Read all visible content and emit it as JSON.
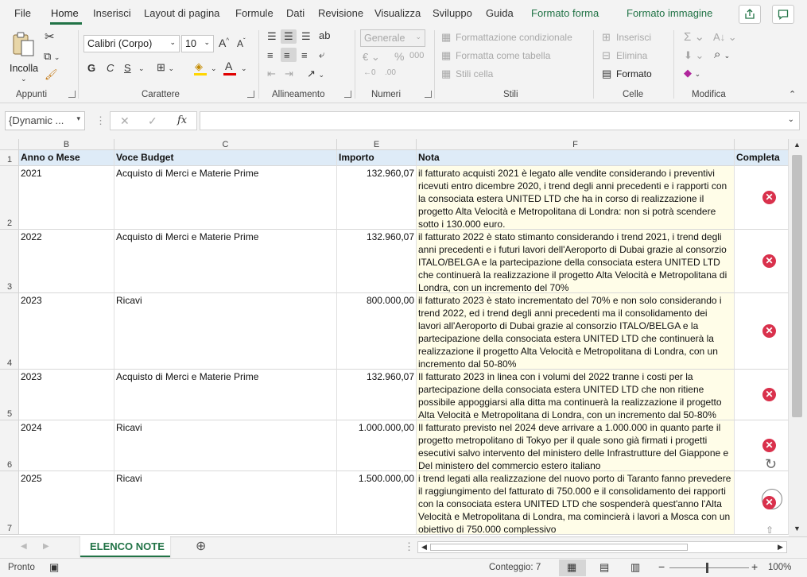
{
  "menu": {
    "items": [
      "File",
      "Home",
      "Inserisci",
      "Layout di pagina",
      "Formule",
      "Dati",
      "Revisione",
      "Visualizza",
      "Sviluppo",
      "Guida",
      "Formato forma",
      "Formato immagine"
    ]
  },
  "ribbon": {
    "clipboard": {
      "paste_label": "Incolla",
      "group_label": "Appunti"
    },
    "font": {
      "font_name": "Calibri (Corpo)",
      "font_size": "10",
      "bold": "G",
      "italic": "C",
      "underline": "S",
      "group_label": "Carattere"
    },
    "alignment": {
      "group_label": "Allineamento"
    },
    "number": {
      "format": "Generale",
      "group_label": "Numeri"
    },
    "styles": {
      "conditional": "Formattazione condizionale",
      "as_table": "Formatta come tabella",
      "cell_styles": "Stili cella",
      "group_label": "Stili"
    },
    "cells": {
      "insert": "Inserisci",
      "delete": "Elimina",
      "format": "Formato",
      "group_label": "Celle"
    },
    "editing": {
      "group_label": "Modifica"
    }
  },
  "formula_bar": {
    "name_box": "{Dynamic ...",
    "fx": "fx",
    "content": ""
  },
  "columns": [
    "B",
    "C",
    "E",
    "F"
  ],
  "headers": {
    "b": "Anno o Mese",
    "c": "Voce Budget",
    "e": "Importo",
    "f": "Nota",
    "g": "Completa"
  },
  "rows": [
    {
      "num": "2",
      "year": "2021",
      "item": "Acquisto di Merci e Materie Prime",
      "amount": "132.960,07",
      "note": "il fatturato acquisti 2021 è legato alle vendite considerando i preventivi ricevuti entro dicembre 2020, i trend degli anni precedenti e i rapporti con la consociata estera UNITED LTD che ha in corso di realizzazione il progetto Alta Velocità e Metropolitana di Londra: non si potrà scendere sotto i 130.000 euro."
    },
    {
      "num": "3",
      "year": "2022",
      "item": "Acquisto di Merci e Materie Prime",
      "amount": "132.960,07",
      "note": "il fatturato 2022 è stato stimanto considerando i trend 2021, i trend degli anni precedenti e i futuri lavori dell'Aeroporto di Dubai grazie al consorzio ITALO/BELGA e la partecipazione della consociata estera UNITED LTD che continuerà la realizzazione il progetto Alta Velocità e Metropolitana di Londra, con un incremento del 70%"
    },
    {
      "num": "4",
      "year": "2023",
      "item": "Ricavi",
      "amount": "800.000,00",
      "note": "il fatturato 2023 è stato incrementato del 70% e non solo considerando i trend 2022, ed  i trend degli anni precedenti ma il consolidamento dei lavori all'Aeroporto di Dubai grazie al consorzio ITALO/BELGA e la partecipazione della consociata estera UNITED LTD che continuerà la realizzazione il progetto Alta Velocità e Metropolitana di Londra, con un incremento dal 50-80%"
    },
    {
      "num": "5",
      "year": "2023",
      "item": "Acquisto di Merci e Materie Prime",
      "amount": "132.960,07",
      "note": "Il fatturato 2023 in linea con i volumi del 2022 tranne i costi per la partecipazione della consociata estera UNITED LTD che non ritiene possibile appoggiarsi alla ditta ma continuerà la realizzazione il progetto Alta Velocità e Metropolitana di Londra, con un incremento dal 50-80%"
    },
    {
      "num": "6",
      "year": "2024",
      "item": "Ricavi",
      "amount": "1.000.000,00",
      "note": "Il fatturato previsto nel 2024 deve arrivare a 1.000.000 in quanto parte il progetto metropolitano di Tokyo per il quale sono già firmati i progetti esecutivi salvo intervento del ministero delle Infrastrutture del Giappone e Del ministero del commercio estero italiano"
    },
    {
      "num": "7",
      "year": "2025",
      "item": "Ricavi",
      "amount": "1.500.000,00",
      "note": "i trend legati alla realizzazione del nuovo porto di Taranto fanno prevedere il raggiungimento del fatturato di 750.000 e il consolidamento dei rapporti con la consociata estera UNITED LTD che sospenderà quest'anno l'Alta Velocità e Metropolitana di Londra, ma comincierà i lavori a Mosca con un obiettivo di 750.000 complessivo"
    }
  ],
  "sheet_tab": "ELENCO NOTE",
  "status": {
    "ready": "Pronto",
    "count": "Conteggio: 7",
    "zoom": "100%"
  },
  "colors": {
    "accent": "#217346",
    "header_fill": "#deebf7",
    "note_fill": "#fffde8",
    "error": "#d9314c"
  }
}
